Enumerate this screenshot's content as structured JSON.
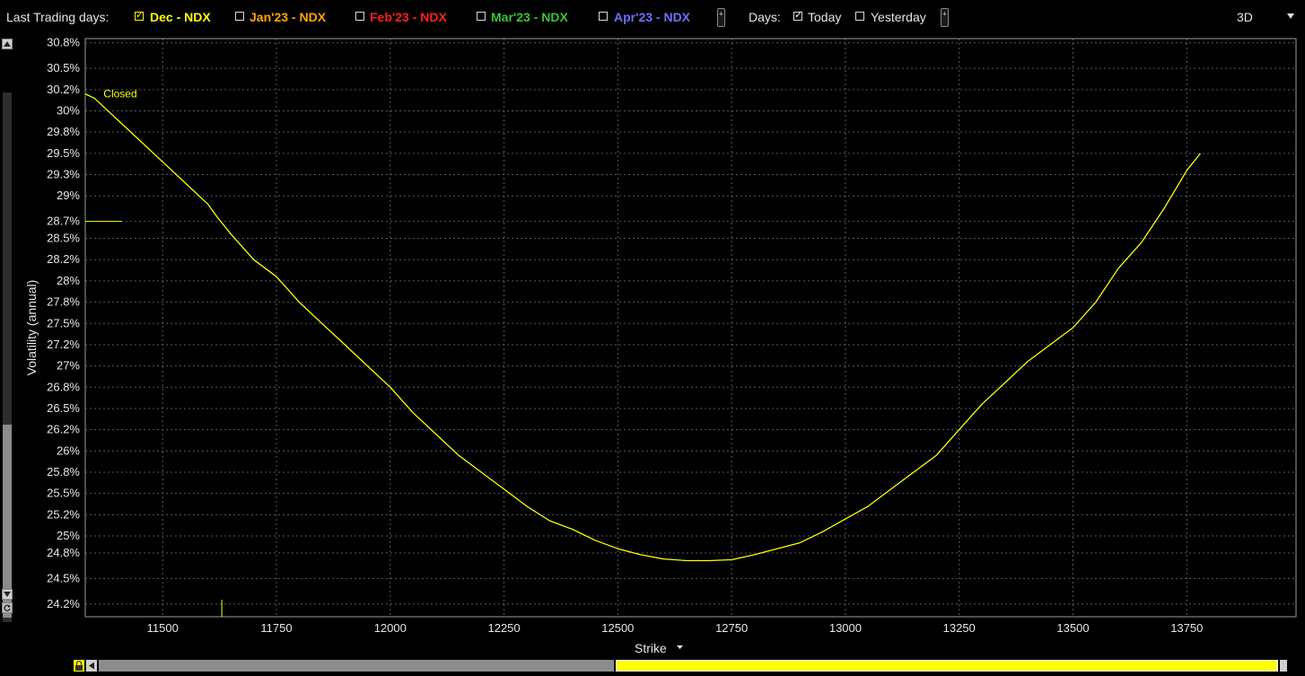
{
  "toolbar": {
    "last_trading_label": "Last Trading days:",
    "series": [
      {
        "label": "Dec - NDX",
        "color": "#ffff00",
        "checked": true
      },
      {
        "label": "Jan'23 - NDX",
        "color": "#ffa500",
        "checked": false
      },
      {
        "label": "Feb'23 - NDX",
        "color": "#ff2020",
        "checked": false
      },
      {
        "label": "Mar'23 - NDX",
        "color": "#3cc23c",
        "checked": false
      },
      {
        "label": "Apr'23 - NDX",
        "color": "#6e6eff",
        "checked": false
      }
    ],
    "days_label": "Days:",
    "today_label": "Today",
    "yesterday_label": "Yesterday",
    "view_mode": "3D"
  },
  "chart_data": {
    "type": "line",
    "xlabel": "Strike",
    "ylabel": "Volatility (annual)",
    "xlim": [
      11330,
      13990
    ],
    "ylim": [
      24.05,
      30.85
    ],
    "x_ticks": [
      11500,
      11750,
      12000,
      12250,
      12500,
      12750,
      13000,
      13250,
      13500,
      13750
    ],
    "y_ticks": [
      {
        "v": 24.2,
        "label": "24.2%"
      },
      {
        "v": 24.5,
        "label": "24.5%"
      },
      {
        "v": 24.8,
        "label": "24.8%"
      },
      {
        "v": 25.0,
        "label": "25%"
      },
      {
        "v": 25.25,
        "label": "25.2%"
      },
      {
        "v": 25.5,
        "label": "25.5%"
      },
      {
        "v": 25.75,
        "label": "25.8%"
      },
      {
        "v": 26.0,
        "label": "26%"
      },
      {
        "v": 26.25,
        "label": "26.2%"
      },
      {
        "v": 26.5,
        "label": "26.5%"
      },
      {
        "v": 26.75,
        "label": "26.8%"
      },
      {
        "v": 27.0,
        "label": "27%"
      },
      {
        "v": 27.25,
        "label": "27.2%"
      },
      {
        "v": 27.5,
        "label": "27.5%"
      },
      {
        "v": 27.75,
        "label": "27.8%"
      },
      {
        "v": 28.0,
        "label": "28%"
      },
      {
        "v": 28.25,
        "label": "28.2%"
      },
      {
        "v": 28.5,
        "label": "28.5%"
      },
      {
        "v": 28.7,
        "label": "28.7%"
      },
      {
        "v": 29.0,
        "label": "29%"
      },
      {
        "v": 29.25,
        "label": "29.3%"
      },
      {
        "v": 29.5,
        "label": "29.5%"
      },
      {
        "v": 29.75,
        "label": "29.8%"
      },
      {
        "v": 30.0,
        "label": "30%"
      },
      {
        "v": 30.25,
        "label": "30.2%"
      },
      {
        "v": 30.5,
        "label": "30.5%"
      },
      {
        "v": 30.8,
        "label": "30.8%"
      }
    ],
    "grid": true,
    "series": [
      {
        "name": "Dec - NDX",
        "color": "#ffff00",
        "x": [
          11330,
          11350,
          11400,
          11450,
          11500,
          11550,
          11600,
          11620,
          11650,
          11700,
          11750,
          11800,
          11850,
          11900,
          11950,
          12000,
          12050,
          12100,
          12150,
          12200,
          12250,
          12300,
          12350,
          12400,
          12450,
          12500,
          12550,
          12600,
          12650,
          12700,
          12750,
          12800,
          12850,
          12900,
          12950,
          13000,
          13050,
          13100,
          13150,
          13200,
          13250,
          13300,
          13350,
          13400,
          13450,
          13500,
          13550,
          13600,
          13650,
          13700,
          13750,
          13780
        ],
        "values": [
          30.2,
          30.15,
          29.9,
          29.65,
          29.4,
          29.15,
          28.9,
          28.75,
          28.55,
          28.25,
          28.05,
          27.75,
          27.5,
          27.25,
          27.0,
          26.75,
          26.45,
          26.2,
          25.95,
          25.75,
          25.55,
          25.35,
          25.18,
          25.08,
          24.95,
          24.85,
          24.78,
          24.73,
          24.71,
          24.71,
          24.72,
          24.78,
          24.85,
          24.92,
          25.05,
          25.2,
          25.35,
          25.55,
          25.75,
          25.95,
          26.25,
          26.55,
          26.8,
          27.05,
          27.25,
          27.45,
          27.75,
          28.15,
          28.45,
          28.85,
          29.3,
          29.5
        ]
      }
    ],
    "annotations": [
      {
        "text": "Closed",
        "x": 11370,
        "y": 30.2,
        "color": "#ffff00"
      }
    ],
    "markers": [
      {
        "type": "hline",
        "x_from": 11330,
        "x_to": 11410,
        "y": 28.7,
        "color": "#ffff00"
      },
      {
        "type": "vline",
        "x": 11630,
        "y_from": 24.05,
        "y_to": 24.25,
        "color": "#ffff00"
      }
    ]
  }
}
